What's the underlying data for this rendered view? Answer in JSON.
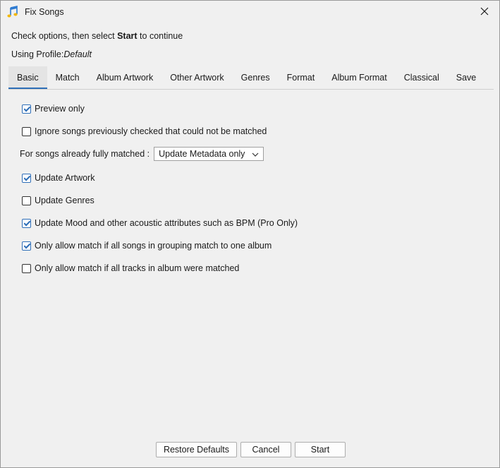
{
  "window": {
    "title": "Fix Songs",
    "close_symbol": "✕"
  },
  "instructions": {
    "prefix": "Check options, then select ",
    "bold": "Start",
    "suffix": " to continue"
  },
  "profile": {
    "label": "Using Profile:",
    "value": "Default"
  },
  "tabs": [
    {
      "label": "Basic",
      "active": true
    },
    {
      "label": "Match"
    },
    {
      "label": "Album Artwork"
    },
    {
      "label": "Other Artwork"
    },
    {
      "label": "Genres"
    },
    {
      "label": "Format"
    },
    {
      "label": "Album Format"
    },
    {
      "label": "Classical"
    },
    {
      "label": "Save"
    }
  ],
  "options": {
    "preview_only": {
      "label": "Preview only",
      "checked": true
    },
    "ignore_previous": {
      "label": "Ignore songs previously checked that could not be matched",
      "checked": false
    },
    "already_matched": {
      "label": "For songs already fully matched :",
      "value": "Update Metadata only"
    },
    "update_artwork": {
      "label": "Update Artwork",
      "checked": true
    },
    "update_genres": {
      "label": "Update Genres",
      "checked": false
    },
    "update_mood": {
      "label": "Update Mood and other acoustic attributes such as BPM (Pro Only)",
      "checked": true
    },
    "grouping_match": {
      "label": "Only allow match if all songs in grouping match to one album",
      "checked": true
    },
    "all_tracks": {
      "label": "Only allow match if all tracks in album were matched",
      "checked": false
    }
  },
  "buttons": {
    "restore": "Restore Defaults",
    "cancel": "Cancel",
    "start": "Start"
  },
  "colors": {
    "accent": "#2f6fb8",
    "background": "#f0f0f0"
  },
  "icons": {
    "app": "music-note-icon",
    "close": "close-icon",
    "dropdown": "chevron-down-icon"
  }
}
